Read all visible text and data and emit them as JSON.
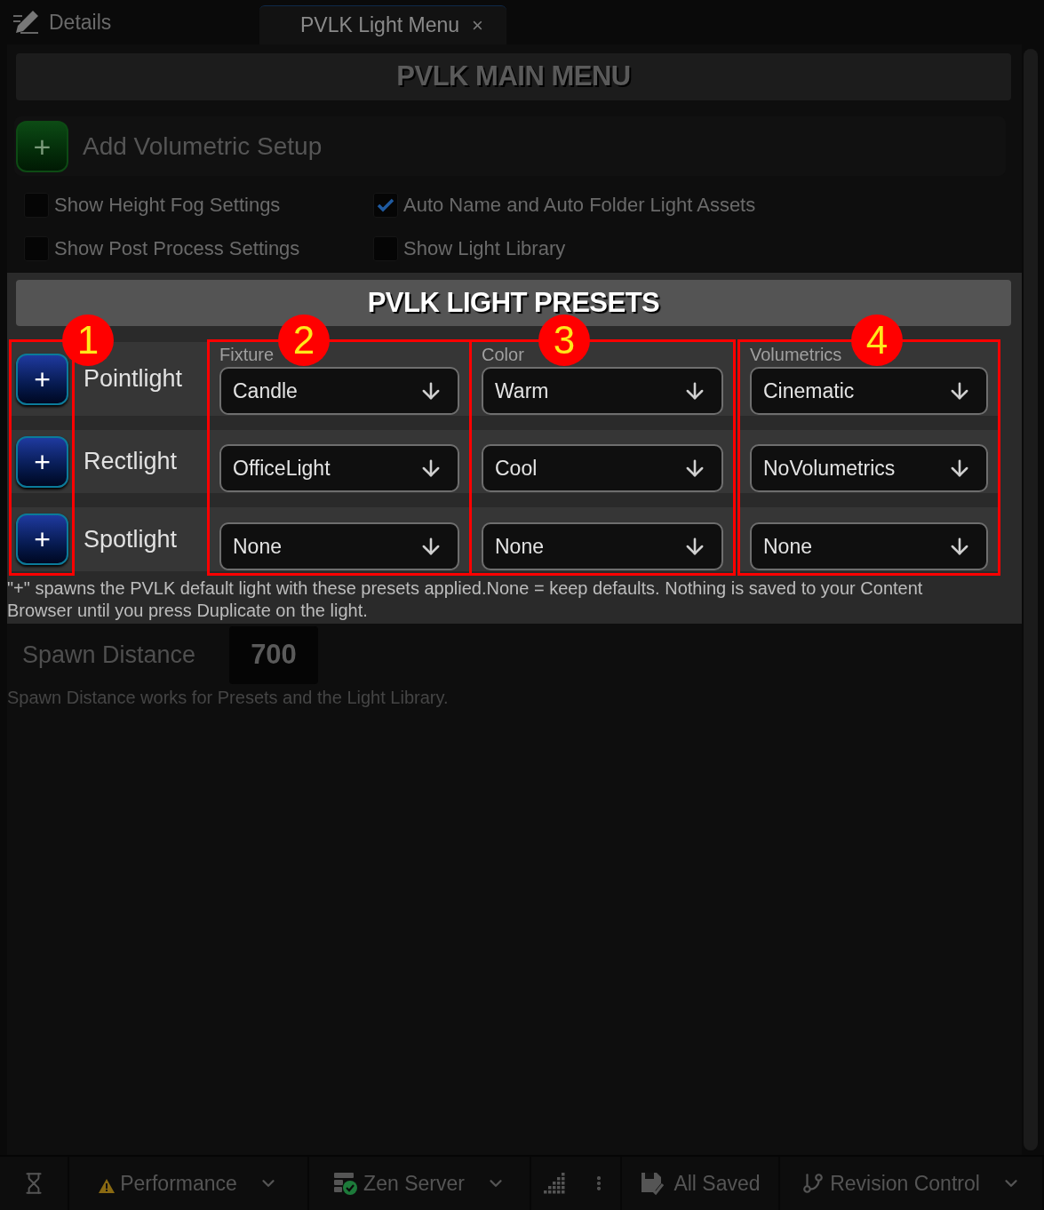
{
  "top_bar": {
    "panel_title": "Details",
    "tab": {
      "label": "PVLK Light Menu",
      "close": "×"
    }
  },
  "main_menu": {
    "title": "PVLK MAIN MENU",
    "add_button": {
      "icon_text": "+",
      "label": "Add Volumetric Setup"
    },
    "options": [
      {
        "label": "Show Height Fog Settings",
        "checked": false
      },
      {
        "label": "Auto Name and Auto Folder Light Assets",
        "checked": true
      },
      {
        "label": "Show Post Process Settings",
        "checked": false
      },
      {
        "label": "Show Light Library",
        "checked": false
      }
    ]
  },
  "presets": {
    "title": "PVLK LIGHT PRESETS",
    "callouts": [
      {
        "label": "1"
      },
      {
        "label": "2"
      },
      {
        "label": "3"
      },
      {
        "label": "4"
      }
    ],
    "lights": [
      {
        "name": "Pointlight",
        "button": "+"
      },
      {
        "name": "Rectlight",
        "button": "+"
      },
      {
        "name": "Spotlight",
        "button": "+"
      }
    ],
    "columns": [
      {
        "label": "Fixture",
        "values": [
          "Candle",
          "OfficeLight",
          "None"
        ]
      },
      {
        "label": "Color",
        "values": [
          "Warm",
          "Cool",
          "None"
        ]
      },
      {
        "label": "Volumetrics",
        "values": [
          "Cinematic",
          "NoVolumetrics",
          "None"
        ]
      }
    ],
    "note": "\"+\" spawns the PVLK default light with these presets applied.None = keep defaults. Nothing is saved to your Content Browser until you press Duplicate on the light."
  },
  "spawn_distance": {
    "label": "Spawn Distance",
    "value": "700",
    "hint": "Spawn Distance works for Presets and the Light Library."
  },
  "status_bar": {
    "items": [
      {
        "kind": "icon"
      },
      {
        "kind": "dropdown",
        "label": "Performance"
      },
      {
        "kind": "dropdown",
        "label": "Zen Server"
      },
      {
        "kind": "icon"
      },
      {
        "kind": "button",
        "label": "All Saved"
      },
      {
        "kind": "dropdown",
        "label": "Revision Control"
      }
    ]
  }
}
